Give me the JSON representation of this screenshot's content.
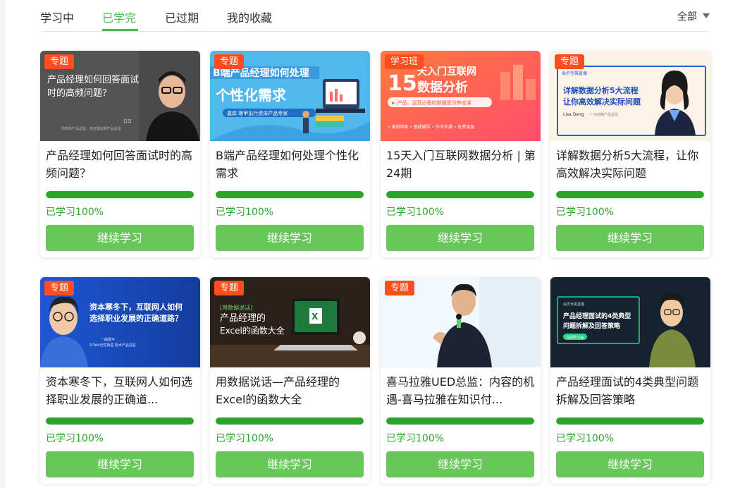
{
  "tabs": [
    {
      "label": "学习中",
      "active": false
    },
    {
      "label": "已学完",
      "active": true
    },
    {
      "label": "已过期",
      "active": false
    },
    {
      "label": "我的收藏",
      "active": false
    }
  ],
  "filter": {
    "label": "全部"
  },
  "colors": {
    "accent": "#4cba4c",
    "progress": "#2aa52a",
    "button": "#67c759",
    "badge": "#ff4d1f"
  },
  "courses": [
    {
      "badge": "专题",
      "title": "产品经理如何回答面试时的高频问题？",
      "progress_label": "已学习100%",
      "progress": 1.0,
      "button": "继续学习",
      "cover": {
        "line1": "产品经理如何回答面试",
        "line2": "时的高频问题？",
        "name": "白日",
        "desc": "前寺库产品总监、前吉银/JJ网产品总监"
      }
    },
    {
      "badge": "专题",
      "title": "B端产品经理如何处理个性化需求",
      "progress_label": "已学习100%",
      "progress": 1.0,
      "button": "继续学习",
      "cover": {
        "line1": "B端产品经理如何处理",
        "line2": "个性化需求",
        "tag": "嘉宾 喀甲出行资深产品专家"
      }
    },
    {
      "badge": "学习班",
      "title": "15天入门互联网数据分析 | 第24期",
      "progress_label": "已学习100%",
      "progress": 1.0,
      "button": "继续学习",
      "cover": {
        "big": "15",
        "line1": "天入门互联网",
        "line2": "数据分析",
        "sub": "► 产品、运营必备的数据意识养成课",
        "tags": "• 案例带练  • 答疑辅导  • 作业实操  • 优秀奖励"
      }
    },
    {
      "badge": "专题",
      "title": "详解数据分析5大流程，让你高效解决实际问题",
      "progress_label": "已学习100%",
      "progress": 1.0,
      "button": "继续学习",
      "cover": {
        "top": "会员专属直播",
        "line1": "详解数据分析5大流程",
        "line2": "让你高效解决实际问题",
        "name": "Lisa Deng",
        "desc": "广州前鳞产品总监"
      }
    },
    {
      "badge": "专题",
      "title": "资本寒冬下，互联网人如何选择职业发展的正确道...",
      "progress_label": "已学习100%",
      "progress": 1.0,
      "button": "继续学习",
      "cover": {
        "line1": "资本寒冬下，互联网人如何",
        "line2": "选择职业发展的正确道路？",
        "name": "一曲建平",
        "desc": "SiTalk无忧英语 技术产品总监"
      }
    },
    {
      "badge": "专题",
      "title": "用数据说话—产品经理的Excel的函数大全",
      "progress_label": "已学习100%",
      "progress": 1.0,
      "button": "继续学习",
      "cover": {
        "tag": "[用数据说话]",
        "line1": "产品经理的",
        "line2": "Excel的函数大全"
      }
    },
    {
      "badge": "专题",
      "title": "喜马拉雅UED总监：内容的机遇-喜马拉雅在知识付...",
      "progress_label": "已学习100%",
      "progress": 1.0,
      "button": "继续学习",
      "cover": {}
    },
    {
      "badge": "",
      "title": "产品经理面试的4类典型问题拆解及回答策略",
      "progress_label": "已学习100%",
      "progress": 1.0,
      "button": "继续学习",
      "cover": {
        "top": "会员专属直播",
        "line1": "产品经理面试的4类典型",
        "line2": "问题拆解及回答策略",
        "cta": "立即学习 ▶"
      }
    }
  ]
}
